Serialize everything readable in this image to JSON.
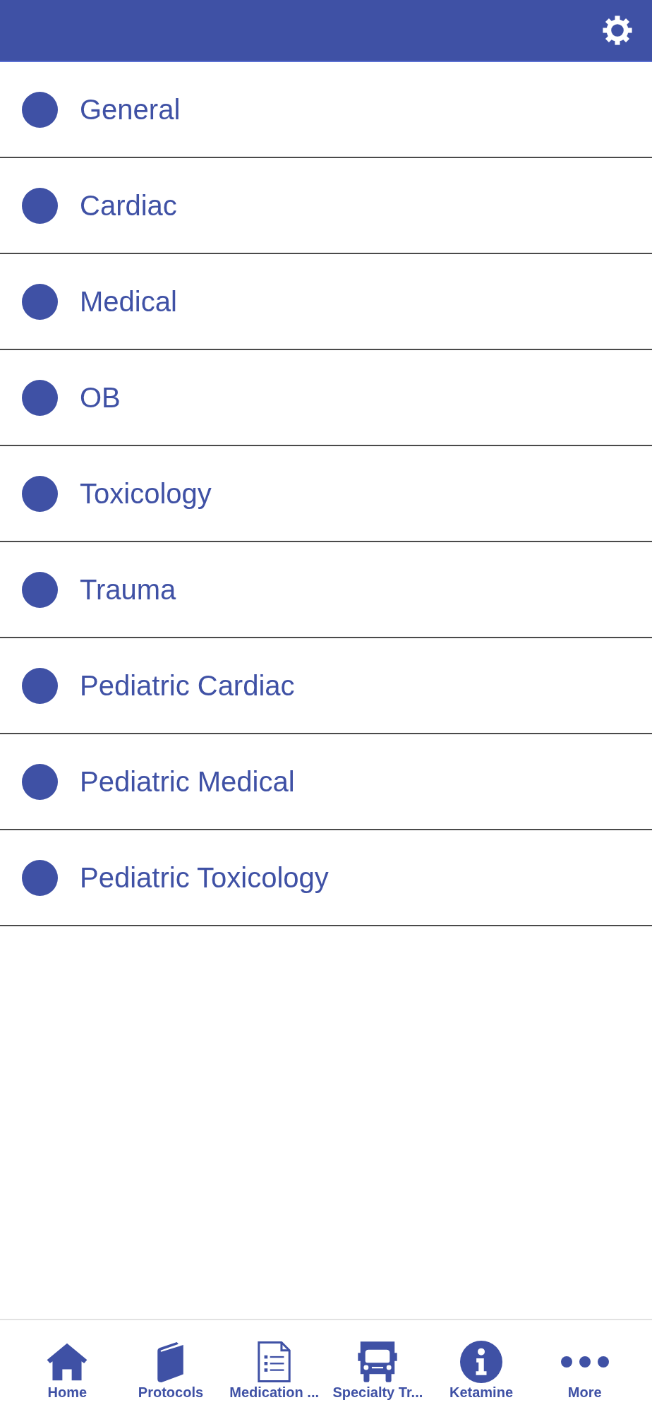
{
  "list": {
    "items": [
      {
        "label": "General"
      },
      {
        "label": "Cardiac"
      },
      {
        "label": "Medical"
      },
      {
        "label": "OB"
      },
      {
        "label": "Toxicology"
      },
      {
        "label": "Trauma"
      },
      {
        "label": "Pediatric Cardiac"
      },
      {
        "label": "Pediatric Medical"
      },
      {
        "label": "Pediatric Toxicology"
      }
    ]
  },
  "tab_bar": {
    "tabs": [
      {
        "label": "Home",
        "kind": "home"
      },
      {
        "label": "Protocols",
        "kind": "book"
      },
      {
        "label": "Medication ...",
        "kind": "document"
      },
      {
        "label": "Specialty Tr...",
        "kind": "truck"
      },
      {
        "label": "Ketamine",
        "kind": "info"
      },
      {
        "label": "More",
        "kind": "more"
      }
    ]
  }
}
